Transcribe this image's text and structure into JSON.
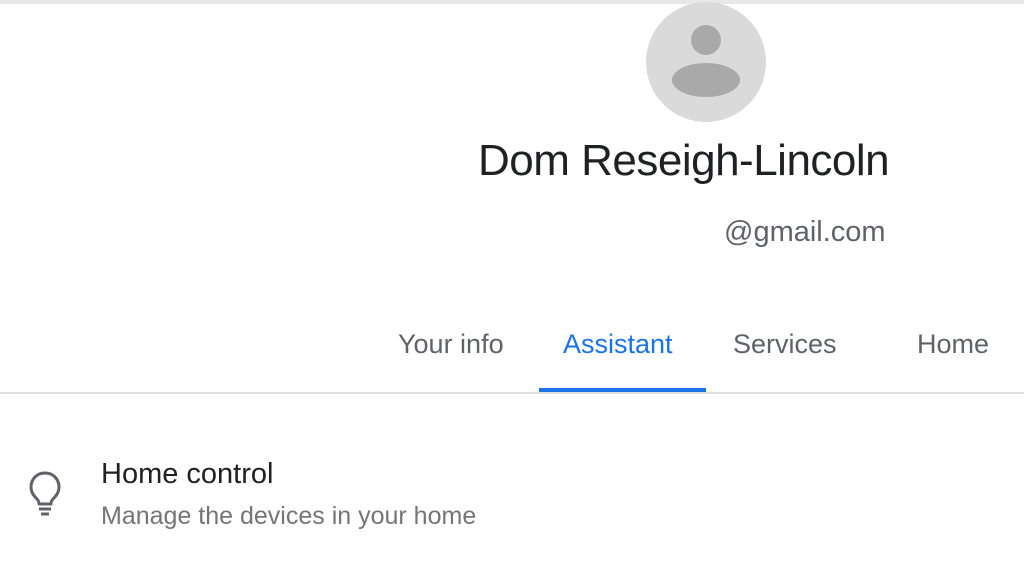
{
  "profile": {
    "name": "Dom Reseigh-Lincoln",
    "email": "@gmail.com",
    "avatar_icon": "default-person-avatar-icon"
  },
  "tabs": [
    {
      "label": "Your info",
      "active": false
    },
    {
      "label": "Assistant",
      "active": true
    },
    {
      "label": "Services",
      "active": false
    },
    {
      "label": "Home",
      "active": false
    }
  ],
  "list": {
    "items": [
      {
        "title": "Home control",
        "subtitle": "Manage the devices in your home",
        "icon": "lightbulb-icon"
      }
    ]
  },
  "colors": {
    "accent": "#1a73e8",
    "text_primary": "#202124",
    "text_secondary": "#5f6368",
    "avatar_bg": "#dadada",
    "avatar_fg": "#a9a9a9"
  }
}
